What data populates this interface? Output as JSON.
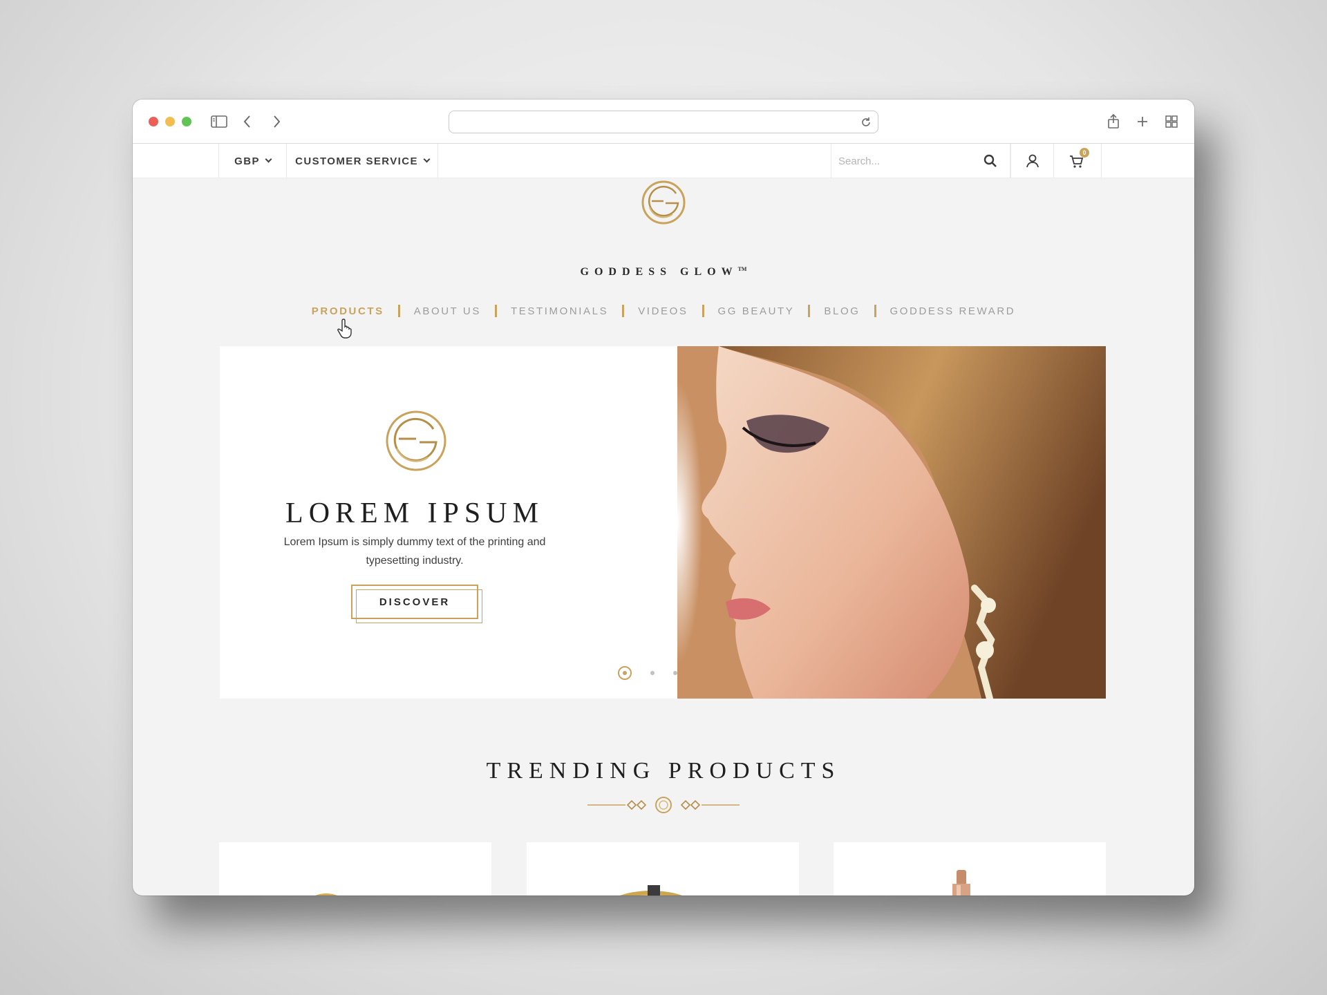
{
  "browser": {
    "address_placeholder": ""
  },
  "topbar": {
    "currency": "GBP",
    "customer_service": "CUSTOMER SERVICE",
    "search_placeholder": "Search...",
    "cart_count": "0"
  },
  "brand": {
    "name": "GODDESS GLOW",
    "tm": "TM"
  },
  "nav": {
    "items": [
      {
        "label": "PRODUCTS",
        "active": true
      },
      {
        "label": "ABOUT US",
        "active": false
      },
      {
        "label": "TESTIMONIALS",
        "active": false
      },
      {
        "label": "VIDEOS",
        "active": false
      },
      {
        "label": "GG BEAUTY",
        "active": false
      },
      {
        "label": "BLOG",
        "active": false
      },
      {
        "label": "GODDESS REWARD",
        "active": false
      }
    ]
  },
  "hero": {
    "title": "LOREM IPSUM",
    "description": "Lorem Ipsum is simply dummy text of the printing and typesetting industry.",
    "cta": "DISCOVER",
    "slides": 4,
    "active_slide": 1
  },
  "trending": {
    "title": "TRENDING PRODUCTS"
  },
  "colors": {
    "accent_gold": "#c9a25c",
    "text_dark": "#2a2a2a",
    "nav_grey": "#9c9c9c",
    "page_bg": "#f3f3f3"
  },
  "icons": [
    "sidebar-icon",
    "back-icon",
    "forward-icon",
    "reload-icon",
    "share-icon",
    "new-tab-icon",
    "tab-overview-icon",
    "search-icon",
    "user-icon",
    "cart-icon",
    "hand-cursor-icon",
    "brand-logo-icon"
  ]
}
